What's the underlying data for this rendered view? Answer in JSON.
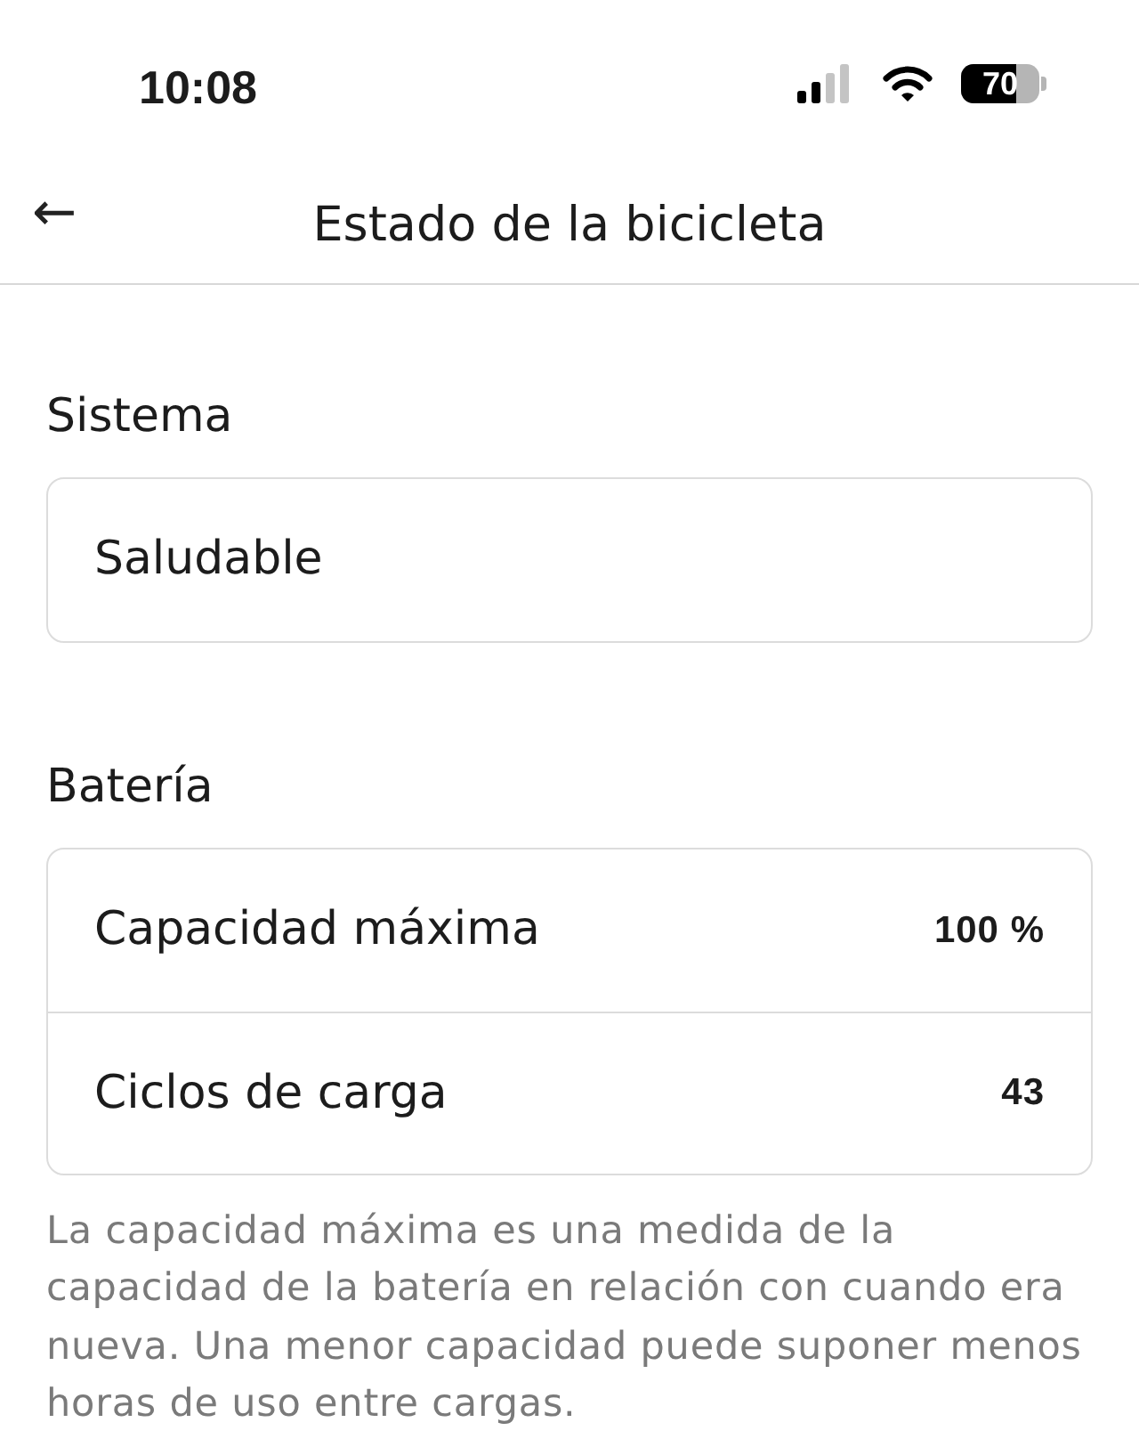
{
  "status_bar": {
    "time": "10:08",
    "battery": "70"
  },
  "header": {
    "back": "←",
    "title": "Estado de la bicicleta"
  },
  "sections": [
    {
      "title": "Sistema",
      "rows": [
        {
          "label": "Saludable"
        }
      ]
    },
    {
      "title": "Batería",
      "rows": [
        {
          "label": "Capacidad máxima",
          "value": "100 %"
        },
        {
          "label": "Ciclos de carga",
          "value": "43"
        }
      ]
    }
  ],
  "footnote": "La capacidad máxima es una medida de la capacidad de la batería en relación con cuando era nueva. Una menor capacidad puede suponer menos horas de uso entre cargas."
}
